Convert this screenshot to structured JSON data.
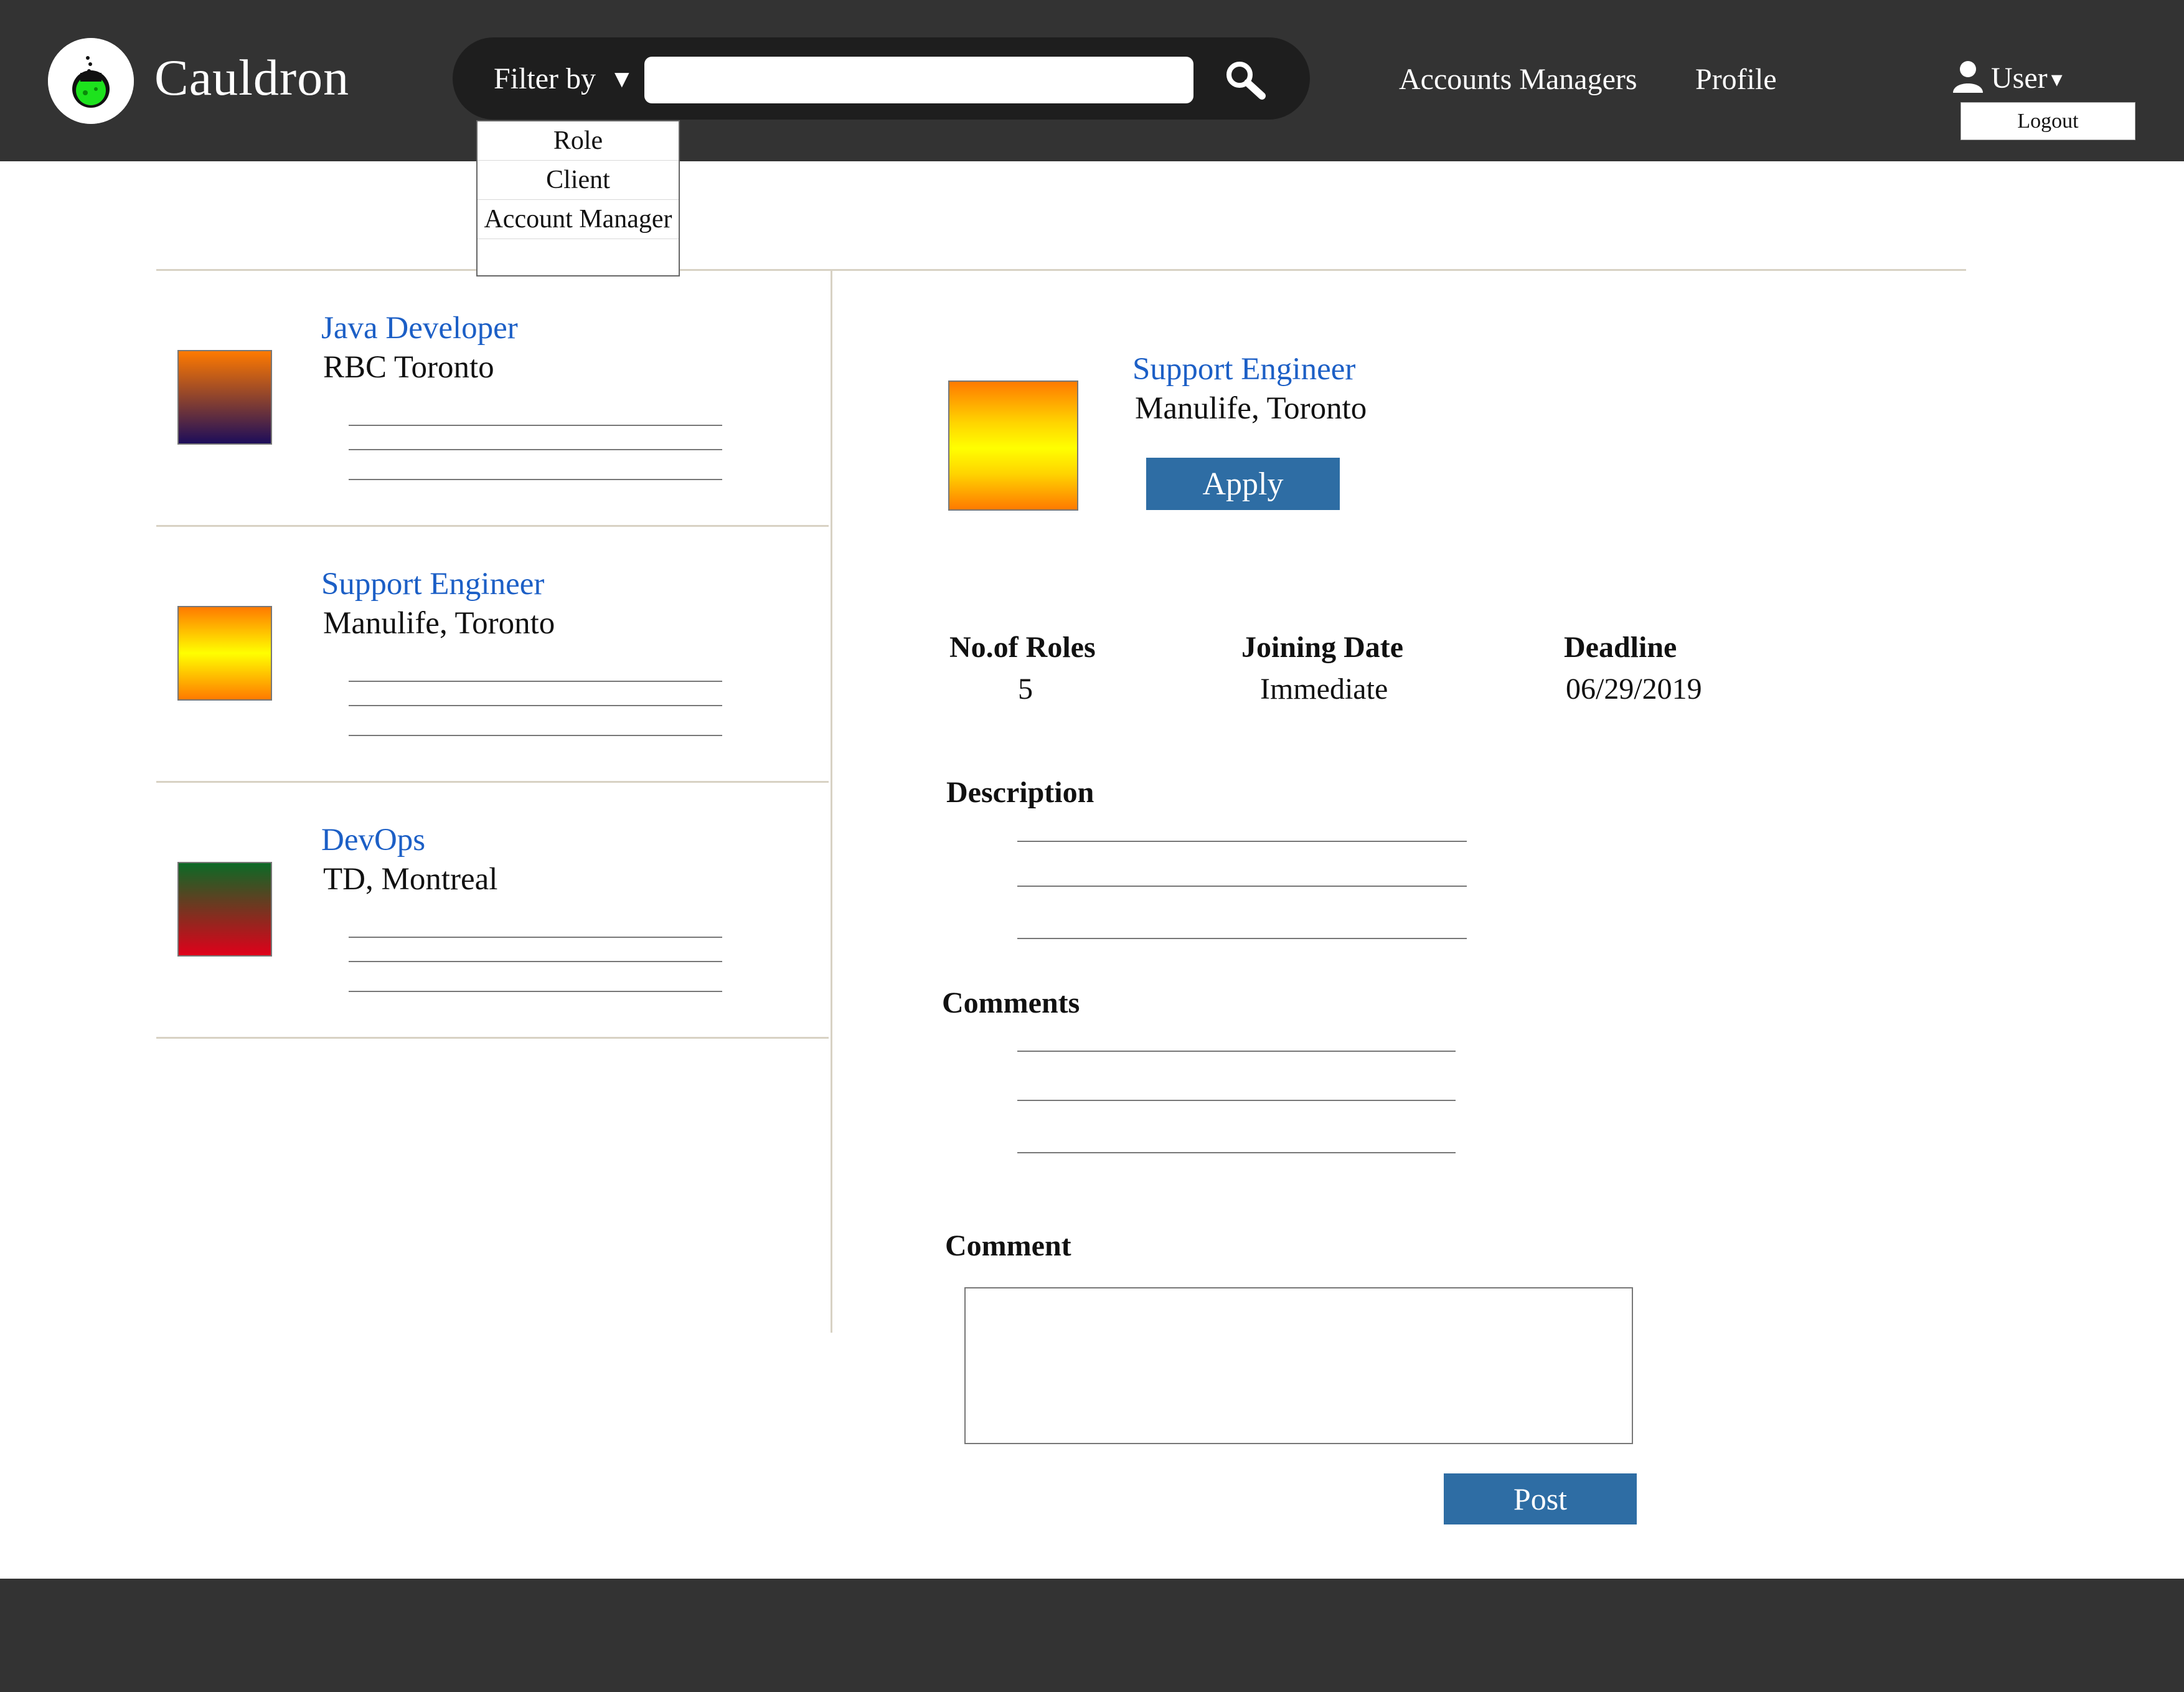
{
  "header": {
    "brand": "Cauldron",
    "filter_label": "Filter by",
    "filter_caret": "▼",
    "search_value": "",
    "search_placeholder": "",
    "search_icon": "magnifier-icon",
    "nav": {
      "accounts_managers": "Accounts Managers",
      "profile": "Profile"
    },
    "user": {
      "label": "User",
      "caret": "▾",
      "icon": "user-silhouette-icon",
      "logout": "Logout"
    }
  },
  "filter_dropdown": {
    "options": [
      "Role",
      "Client",
      "Account Manager",
      ""
    ]
  },
  "jobs": [
    {
      "title": "Java Developer",
      "company": "RBC Toronto",
      "thumb_gradient": [
        "#ff7a00",
        "#1d0d5a"
      ]
    },
    {
      "title": "Support Engineer",
      "company": "Manulife, Toronto",
      "thumb_gradient": [
        "#ff7a00",
        "#ffff00",
        "#ff7a00"
      ]
    },
    {
      "title": "DevOps",
      "company": "TD, Montreal",
      "thumb_gradient": [
        "#0b6a26",
        "#e0001a"
      ]
    }
  ],
  "detail": {
    "title": "Support Engineer",
    "company": "Manulife, Toronto",
    "apply_label": "Apply",
    "stats": {
      "roles_label": "No.of Roles",
      "roles_value": "5",
      "joining_label": "Joining Date",
      "joining_value": "Immediate",
      "deadline_label": "Deadline",
      "deadline_value": "06/29/2019"
    },
    "description_label": "Description",
    "comments_label": "Comments",
    "comment_label": "Comment",
    "comment_value": "",
    "post_label": "Post"
  },
  "colors": {
    "header_bg": "#333333",
    "link_blue": "#1c5fc6",
    "button_blue": "#2e6da4",
    "logo_green": "#1de21d"
  }
}
